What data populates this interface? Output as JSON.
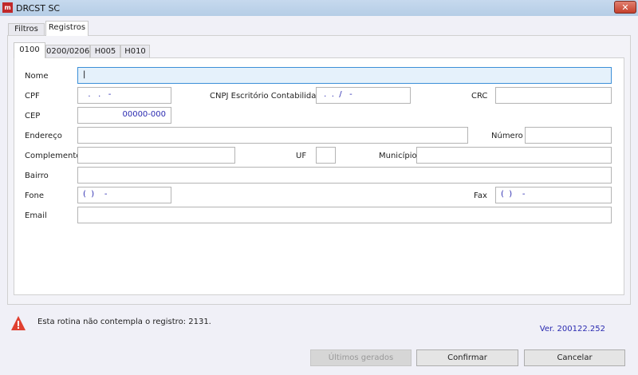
{
  "window": {
    "title": "DRCST SC",
    "close": "✕"
  },
  "outer_tabs": [
    {
      "label": "Filtros"
    },
    {
      "label": "Registros"
    }
  ],
  "inner_tabs": [
    {
      "label": "0100"
    },
    {
      "label": "0200/0206"
    },
    {
      "label": "H005"
    },
    {
      "label": "H010"
    }
  ],
  "form": {
    "nome": {
      "label": "Nome",
      "value": "|"
    },
    "cpf": {
      "label": "CPF",
      "value": "  .   .   -"
    },
    "cnpj": {
      "label": "CNPJ Escritório Contabilidade",
      "value": " .  .  /   -"
    },
    "crc": {
      "label": "CRC",
      "value": ""
    },
    "cep": {
      "label": "CEP",
      "value": "00000-000"
    },
    "endereco": {
      "label": "Endereço",
      "value": ""
    },
    "numero": {
      "label": "Número",
      "value": ""
    },
    "complemento": {
      "label": "Complemento",
      "value": ""
    },
    "uf": {
      "label": "UF",
      "value": ""
    },
    "municipio": {
      "label": "Município",
      "value": ""
    },
    "bairro": {
      "label": "Bairro",
      "value": ""
    },
    "fone": {
      "label": "Fone",
      "value": "(  )    -"
    },
    "fax": {
      "label": "Fax",
      "value": "(  )    -"
    },
    "email": {
      "label": "Email",
      "value": ""
    }
  },
  "status": {
    "message": "Esta rotina não contempla o registro: 2131.",
    "version": "Ver. 200122.252"
  },
  "buttons": {
    "ultimos": "Últimos gerados",
    "confirmar": "Confirmar",
    "cancelar": "Cancelar"
  }
}
